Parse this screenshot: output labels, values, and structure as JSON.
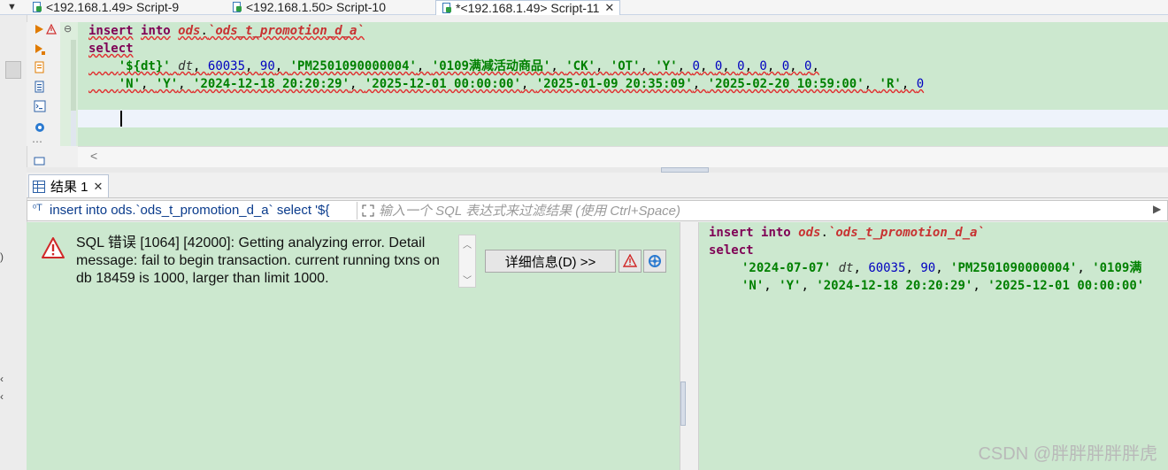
{
  "tabs": [
    {
      "label": "<192.168.1.49> Script-9"
    },
    {
      "label": "<192.168.1.50> Script-10"
    },
    {
      "label": "*<192.168.1.49> Script-11"
    }
  ],
  "editor": {
    "line1": {
      "kw_insert": "insert",
      "kw_into": "into",
      "schema": "ods",
      "dot": ".",
      "table": "`ods_t_promotion_d_a`"
    },
    "line2": {
      "kw_select": "select"
    },
    "line3": {
      "indent": "    ",
      "v1": "'${dt}'",
      "alias": "dt",
      "n1": "60035",
      "n2": "90",
      "s1": "'PM2501090000004'",
      "s2": "'0109满减活动商品'",
      "s3": "'CK'",
      "s4": "'OT'",
      "s5": "'Y'",
      "zeros": [
        "0",
        "0",
        "0",
        "0",
        "0",
        "0"
      ]
    },
    "line4": {
      "indent": "    ",
      "s1": "'N'",
      "s2": "'Y'",
      "s3": "'2024-12-18 20:20:29'",
      "s4": "'2025-12-01 00:00:00'",
      "s5": "'2025-01-09 20:35:09'",
      "s6": "'2025-02-20 10:59:00'",
      "s7": "'R'",
      "n1": "0"
    },
    "hscroll_arrow": "<"
  },
  "results": {
    "tab_label": "结果 1",
    "query_text": "insert into ods.`ods_t_promotion_d_a` select '${",
    "filter_placeholder": "输入一个 SQL 表达式来过滤结果 (使用 Ctrl+Space)",
    "error_message": "SQL 错误 [1064] [42000]: Getting analyzing error. Detail message: fail to begin transaction. current running txns on db 18459 is 1000, larger than limit 1000.",
    "details_button": "详细信息(D) >>",
    "sql": {
      "line1": {
        "kw_insert": "insert",
        "kw_into": "into",
        "schema": "ods",
        "dot": ".",
        "table": "`ods_t_promotion_d_a`"
      },
      "line2": {
        "kw_select": "select"
      },
      "line3": {
        "v1": "'2024-07-07'",
        "alias": "dt",
        "n1": "60035",
        "n2": "90",
        "s1": "'PM2501090000004'",
        "s2": "'0109满"
      },
      "line4": {
        "s1": "'N'",
        "s2": "'Y'",
        "s3": "'2024-12-18 20:20:29'",
        "s4": "'2025-12-01 00:00:00'"
      }
    }
  },
  "watermark": "CSDN @胖胖胖胖胖虎",
  "colors": {
    "editor_bg": "#cce8cf",
    "keyword": "#7f0055",
    "string": "#008000",
    "number": "#0000c0",
    "table": "#c83232"
  }
}
